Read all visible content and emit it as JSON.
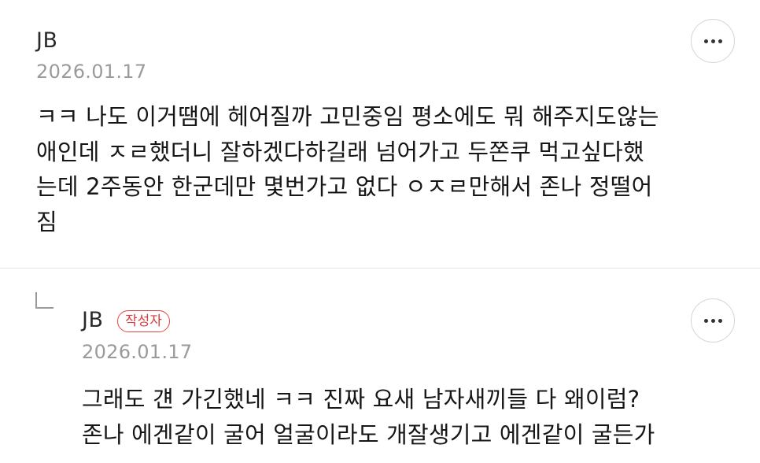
{
  "comments": [
    {
      "author": "JB",
      "date": "2026.01.17",
      "text": "ㅋㅋ 나도 이거땜에 헤어질까 고민중임 평소에도 뭐 해주지도않는\n애인데 ㅈㄹ했더니 잘하겠다하길래 넘어가고 두쫀쿠 먹고싶다했\n는데 2주동안 한군데만 몇번가고 없다 ㅇㅈㄹ만해서 존나 정떨어\n짐",
      "more_icon": "more-horizontal-icon"
    },
    {
      "author": "JB",
      "badge": "작성자",
      "date": "2026.01.17",
      "text": "그래도 걘 가긴했네 ㅋㅋ 진짜 요새 남자새끼들 다 왜이럼?\n존나 에겐같이 굴어 얼굴이라도 개잘생기고 에겐같이 굴든가",
      "reply_icon": "reply-arrow-icon",
      "more_icon": "more-horizontal-icon"
    }
  ],
  "colors": {
    "badge": "#d63a40",
    "date": "#9a9a9a",
    "divider": "#e3e3e3"
  }
}
